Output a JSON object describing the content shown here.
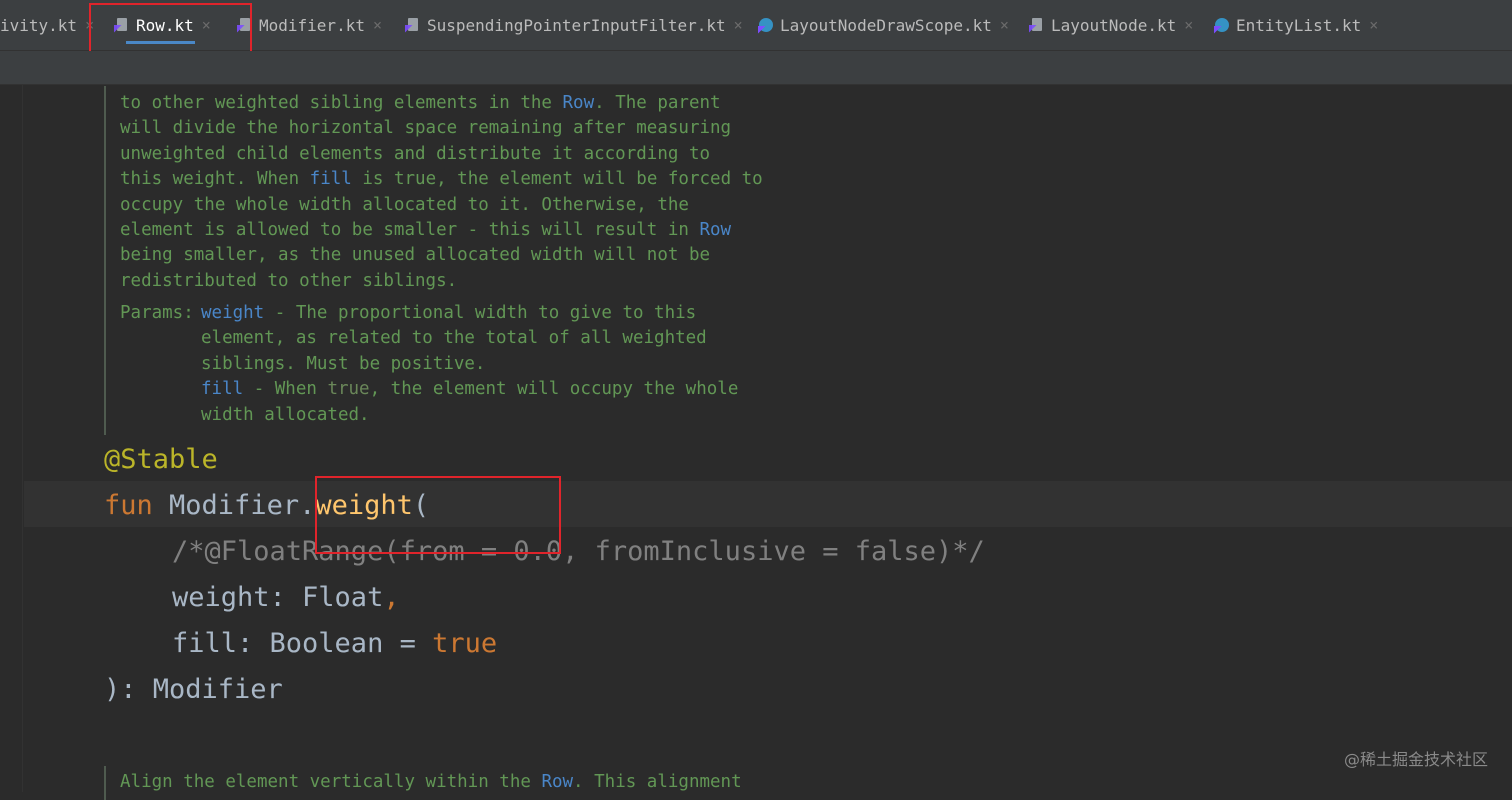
{
  "tabs": [
    {
      "label": "ivity.kt",
      "icon": "kotlin-file-icon",
      "active": false
    },
    {
      "label": "Row.kt",
      "icon": "kotlin-file-icon",
      "active": true
    },
    {
      "label": "Modifier.kt",
      "icon": "kotlin-file-icon",
      "active": false
    },
    {
      "label": "SuspendingPointerInputFilter.kt",
      "icon": "kotlin-file-icon",
      "active": false
    },
    {
      "label": "LayoutNodeDrawScope.kt",
      "icon": "kotlin-class-icon",
      "active": false
    },
    {
      "label": "LayoutNode.kt",
      "icon": "kotlin-file-icon",
      "active": false
    },
    {
      "label": "EntityList.kt",
      "icon": "kotlin-class-icon",
      "active": false
    }
  ],
  "close_glyph": "×",
  "doc_top": {
    "l1a": "to other weighted sibling elements in the ",
    "l1ref": "Row",
    "l1b": ". The parent",
    "l2": "will divide the horizontal space remaining after measuring",
    "l3": "unweighted child elements and distribute it according to",
    "l4a": "this weight. When ",
    "l4ref": "fill",
    "l4b": " is true, the element will be forced to",
    "l5": "occupy the whole width allocated to it. Otherwise, the",
    "l6a": "element is allowed to be smaller - this will result in ",
    "l6ref": "Row",
    "l7": "being smaller, as the unused allocated width will not be",
    "l8": "redistributed to other siblings."
  },
  "params": {
    "label": "Params:",
    "p1name": "weight",
    "p1a": " - The proportional width to give to this",
    "p1b": "element, as related to the total of all weighted",
    "p1c": "siblings. Must be positive.",
    "p2name": "fill",
    "p2a": " - When ",
    "p2code": "true",
    "p2b": ", the element will occupy the whole",
    "p2c": "width allocated."
  },
  "code": {
    "annotation": "@Stable",
    "fun_kw": "fun",
    "receiver": " Modifier.",
    "fn_name": "weight",
    "open_paren": "(",
    "comment": "/*@FloatRange(from = 0.0, fromInclusive = false)*/",
    "param1": "weight: Float",
    "comma": ",",
    "param2": "fill: Boolean = ",
    "true_kw": "true",
    "closing": "): Modifier"
  },
  "doc_bottom": {
    "a": "Align the element vertically within the ",
    "ref": "Row",
    "b": ". This alignment"
  },
  "watermark": "@稀土掘金技术社区"
}
